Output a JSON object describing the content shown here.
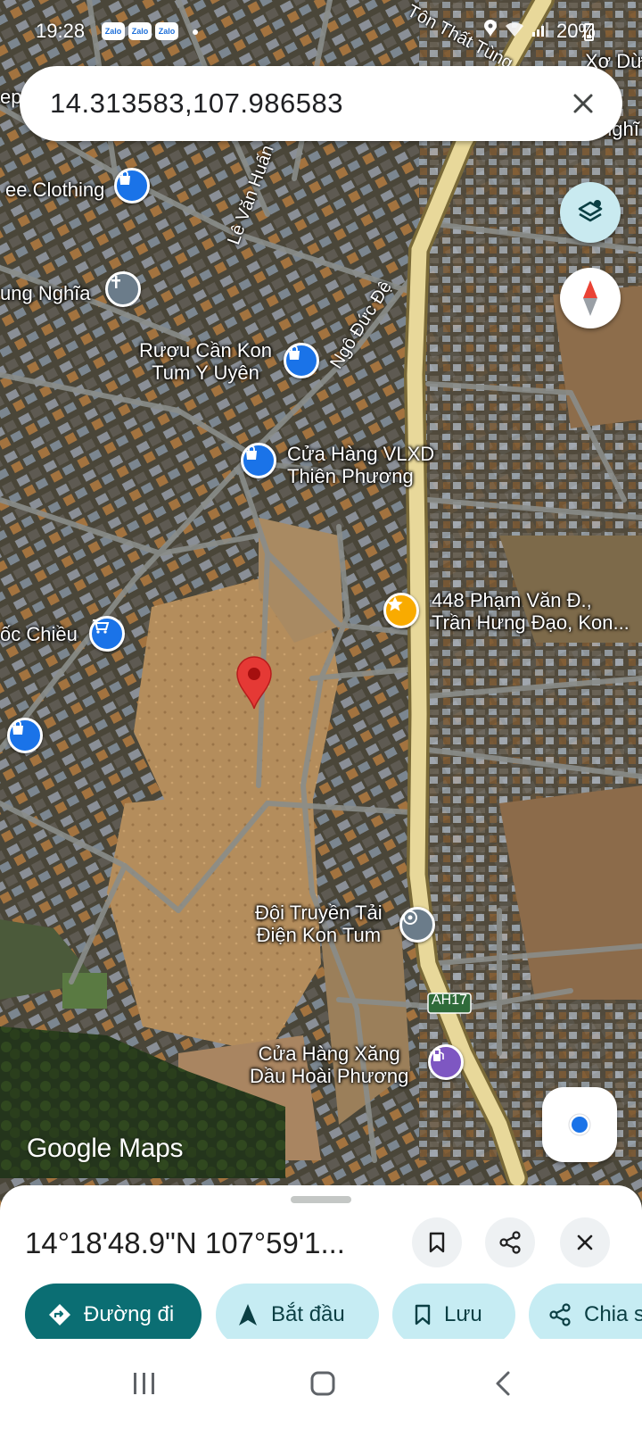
{
  "status_bar": {
    "time": "19:28",
    "notification_apps": [
      "Zalo",
      "Zalo",
      "Zalo"
    ],
    "battery": "20%"
  },
  "search": {
    "query": "14.313583,107.986583"
  },
  "map": {
    "type": "satellite",
    "logo": {
      "brand": "Google",
      "product": "Maps"
    },
    "pin_color": "#e53935",
    "road_label": "AH17",
    "streets": [
      {
        "id": "le-van-huan",
        "name": "Lê Văn Huấn"
      },
      {
        "id": "ngo-duc-de",
        "name": "Ngô Đức Đệ"
      },
      {
        "id": "ton-that-tung",
        "name": "Tôn Thất Tùng"
      }
    ],
    "places": [
      {
        "id": "clothing",
        "lines": [
          "ee.Clothing"
        ],
        "icon": "shopping-bag-icon",
        "color": "#1a73e8"
      },
      {
        "id": "ung-nghia",
        "lines": [
          "ung Nghĩa"
        ],
        "icon": "church-cross-icon",
        "color": "#6b7c8a"
      },
      {
        "id": "ruou-can",
        "lines": [
          "Rượu Cần Kon",
          "Tum Y Uyên"
        ],
        "icon": "shopping-bag-icon",
        "color": "#1a73e8"
      },
      {
        "id": "vlxd",
        "lines": [
          "Cửa Hàng VLXD",
          "Thiên Phương"
        ],
        "icon": "shopping-bag-icon",
        "color": "#1a73e8"
      },
      {
        "id": "pham-van-dong",
        "lines": [
          "448 Phạm Văn Đ.,",
          "Trần Hưng Đạo, Kon..."
        ],
        "icon": "star-icon",
        "color": "#f9ab00"
      },
      {
        "id": "oc-chieu",
        "lines": [
          "ốc Chiều"
        ],
        "icon": "shopping-cart-icon",
        "color": "#1a73e8"
      },
      {
        "id": "doi-truyen-tai",
        "lines": [
          "Đội Truyền Tải",
          "Điện Kon Tum"
        ],
        "icon": "pin-dot-icon",
        "color": "#6b7c8a"
      },
      {
        "id": "xang-dau",
        "lines": [
          "Cửa Hàng Xăng",
          "Dầu Hoài Phương"
        ],
        "icon": "gas-station-icon",
        "color": "#7e57c2"
      }
    ],
    "edge_labels": [
      "Xơ Dừ",
      "nghĩ",
      "ep"
    ]
  },
  "bottom_sheet": {
    "title": "14°18'48.9\"N 107°59'1...",
    "actions": [
      {
        "id": "directions",
        "label": "Đường đi",
        "icon": "directions-icon"
      },
      {
        "id": "start",
        "label": "Bắt đầu",
        "icon": "navigation-arrow-icon"
      },
      {
        "id": "save",
        "label": "Lưu",
        "icon": "bookmark-icon"
      },
      {
        "id": "share",
        "label": "Chia s",
        "icon": "share-icon"
      }
    ]
  },
  "colors": {
    "primary_chip": "#0b6e73",
    "secondary_chip": "#c6ecf3",
    "road_highlight": "#e8d89a"
  }
}
